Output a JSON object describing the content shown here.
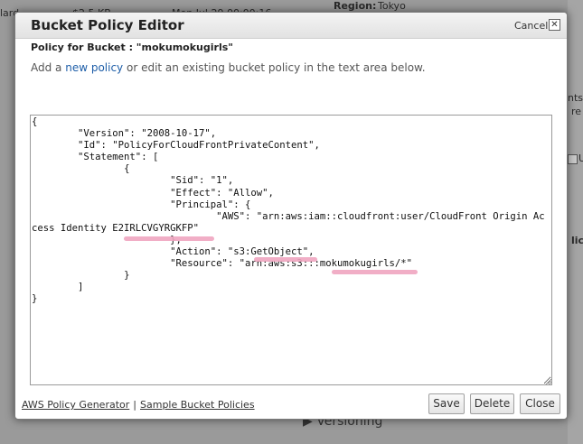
{
  "background": {
    "top_left": "lard",
    "top_size": "$2.5 KB",
    "top_date": "Mon Jul 29 00:00:16",
    "region_label": "Region:",
    "region_value": "Tokyo",
    "frag_nts": "nts",
    "frag_re": "re",
    "frag_u": "U",
    "frag_lic": "lic",
    "versioning": "▶ Versioning"
  },
  "dialog": {
    "title": "Bucket Policy Editor",
    "cancel_label": "Cancel",
    "close_glyph": "✕",
    "subheading": "Policy for Bucket : \"mokumokugirls\"",
    "description_prefix": "Add a ",
    "description_link": "new policy",
    "description_suffix": " or edit an existing bucket policy in the text area below.",
    "policy_text": "{\n        \"Version\": \"2008-10-17\",\n        \"Id\": \"PolicyForCloudFrontPrivateContent\",\n        \"Statement\": [\n                {\n                        \"Sid\": \"1\",\n                        \"Effect\": \"Allow\",\n                        \"Principal\": {\n                                \"AWS\": \"arn:aws:iam::cloudfront:user/CloudFront Origin Access Identity E2IRLCVGYRGKFP\"\n                        },\n                        \"Action\": \"s3:GetObject\",\n                        \"Resource\": \"arn:aws:s3:::mokumokugirls/*\"\n                }\n        ]\n}",
    "footer": {
      "policy_generator": "AWS Policy Generator",
      "separator": "|",
      "sample_policies": "Sample Bucket Policies"
    },
    "buttons": {
      "save": "Save",
      "delete": "Delete",
      "close": "Close"
    }
  }
}
